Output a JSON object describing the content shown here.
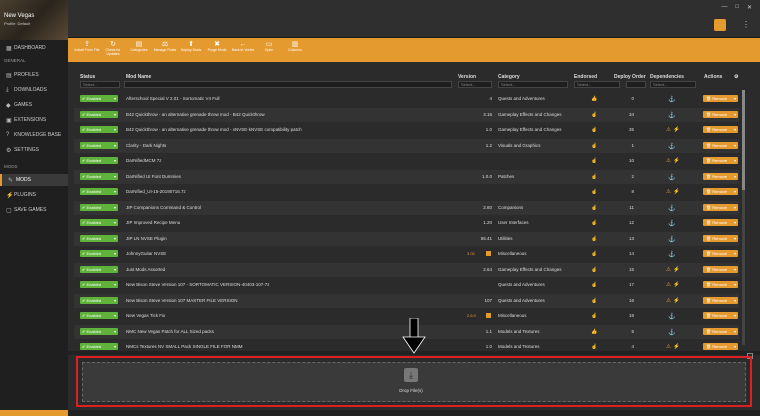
{
  "game": {
    "title": "New Vegas",
    "profile": "Profile: Default"
  },
  "sidebar": {
    "dashboard": "DASHBOARD",
    "general_header": "GENERAL",
    "general": [
      {
        "icon": "profiles-icon",
        "label": "PROFILES"
      },
      {
        "icon": "downloads-icon",
        "label": "DOWNLOADS"
      },
      {
        "icon": "games-icon",
        "label": "GAMES"
      },
      {
        "icon": "extensions-icon",
        "label": "EXTENSIONS"
      },
      {
        "icon": "knowledge-base-icon",
        "label": "KNOWLEDGE BASE"
      },
      {
        "icon": "settings-icon",
        "label": "SETTINGS"
      }
    ],
    "mods_header": "MODS",
    "mods": [
      {
        "icon": "mods-icon",
        "label": "MODS",
        "active": true
      },
      {
        "icon": "plugins-icon",
        "label": "PLUGINS"
      },
      {
        "icon": "save-games-icon",
        "label": "SAVE GAMES"
      }
    ]
  },
  "toolbar": [
    {
      "icon": "install-icon",
      "label": "Install From File"
    },
    {
      "icon": "check-updates-icon",
      "label": "Check for Updates"
    },
    {
      "icon": "categories-icon",
      "label": "Categories"
    },
    {
      "icon": "manage-rules-icon",
      "label": "Manage Rules"
    },
    {
      "icon": "deploy-icon",
      "label": "Deploy Mods"
    },
    {
      "icon": "purge-icon",
      "label": "Purge Mods"
    },
    {
      "icon": "open-folder-icon",
      "label": "Back to Vortex"
    },
    {
      "icon": "open-icon",
      "label": "Open"
    },
    {
      "icon": "columns-icon",
      "label": "Columns"
    }
  ],
  "table": {
    "headers": {
      "status": "Status",
      "mod_name": "Mod Name",
      "version": "Version",
      "category": "Category",
      "endorsed": "Endorsed",
      "deploy_order": "Deploy Order",
      "dependencies": "Dependencies",
      "actions": "Actions"
    },
    "filter_placeholder": "Select...",
    "enabled_label": "Enabled",
    "remove_label": "Remove",
    "rows": [
      {
        "name": "Afterschool Special V 2.01 - Sortomatic V4 Full",
        "version": "4",
        "category": "Quests and Adventures",
        "order": "0",
        "endorsed": true,
        "dep": "dep"
      },
      {
        "name": "B42 Quickthrow - an alternative grenade throw mod - B42 Quickthrow",
        "version": "3.16",
        "category": "Gameplay Effects and Changes",
        "order": "34",
        "endorsed": false,
        "dep": "dep"
      },
      {
        "name": "B42 Quickthrow - an alternative grenade throw mod - xNVSE-kNVSE compatibility patch",
        "version": "1.0",
        "category": "Gameplay Effects and Changes",
        "order": "35",
        "endorsed": false,
        "dep": "warn"
      },
      {
        "name": "Clarity - Dark Nights",
        "version": "1.2",
        "category": "Visuals and Graphics",
        "order": "1",
        "endorsed": false,
        "dep": "dep"
      },
      {
        "name": "DarNifiedMCM 7z",
        "version": "",
        "category": "",
        "order": "10",
        "endorsed": false,
        "dep": "warn"
      },
      {
        "name": "DarNified UI Font Dummies",
        "version": "1.0.0",
        "category": "Patches",
        "order": "2",
        "endorsed": false,
        "dep": "dep"
      },
      {
        "name": "DarNified_UI-15-20190716.7z",
        "version": "",
        "category": "",
        "order": "8",
        "endorsed": false,
        "dep": "warn"
      },
      {
        "name": "JIP Companions Command & Control",
        "version": "2.60",
        "category": "Companions",
        "order": "11",
        "endorsed": false,
        "dep": "dep"
      },
      {
        "name": "JIP Improved Recipe Menu",
        "version": "1.20",
        "category": "User Interfaces",
        "order": "12",
        "endorsed": false,
        "dep": "dep"
      },
      {
        "name": "JIP LN NVSE Plugin",
        "version": "56.41",
        "category": "Utilities",
        "order": "13",
        "endorsed": false,
        "dep": "dep"
      },
      {
        "name": "JohnnyGuitar NVSE",
        "version": "",
        "update": "3.00",
        "category": "Miscellaneous",
        "order": "14",
        "endorsed": false,
        "dep": "dep"
      },
      {
        "name": "Just Mods Assorted",
        "version": "2.64",
        "category": "Gameplay Effects and Changes",
        "order": "15",
        "endorsed": false,
        "dep": "warn"
      },
      {
        "name": "New Bison Steve Version 107 - SORTOMATIC VERSION-40403-107-7z",
        "version": "",
        "category": "Quests and Adventures",
        "order": "17",
        "endorsed": false,
        "dep": "warn"
      },
      {
        "name": "New Bison Steve Version 107 MASTER FILE VERSION",
        "version": "107",
        "category": "Quests and Adventures",
        "order": "16",
        "endorsed": false,
        "dep": "warn"
      },
      {
        "name": "New Vegas Tick Fix",
        "version": "",
        "update": "2.6.0",
        "category": "Miscellaneous",
        "order": "18",
        "endorsed": false,
        "dep": "dep"
      },
      {
        "name": "NMC New Vegas Patch for ALL Sized packs",
        "version": "1.1",
        "category": "Models and Textures",
        "order": "5",
        "endorsed": true,
        "dep": "dep"
      },
      {
        "name": "NMCs Textures NV SMALL Pack SINGLE FILE FOR NMM",
        "version": "1.0",
        "category": "Models and Textures",
        "order": "4",
        "endorsed": false,
        "dep": "warn"
      }
    ]
  },
  "dropzone": {
    "label": "Drop File(s)"
  },
  "colors": {
    "accent": "#e59a30",
    "enabled": "#5fb33a",
    "highlight": "#e02020"
  }
}
